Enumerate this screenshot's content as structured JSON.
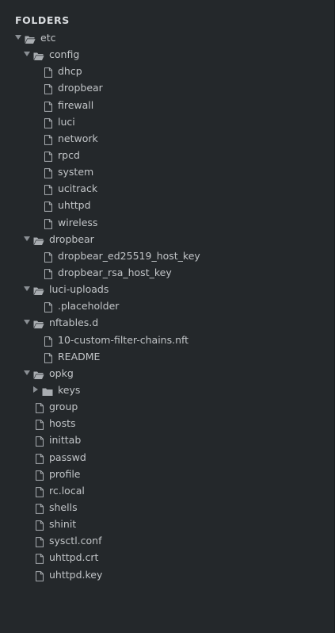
{
  "header": {
    "title": "FOLDERS"
  },
  "tree": [
    {
      "label": "etc",
      "kind": "folder",
      "open": true,
      "depth": 0
    },
    {
      "label": "config",
      "kind": "folder",
      "open": true,
      "depth": 1
    },
    {
      "label": "dhcp",
      "kind": "file",
      "depth": 2
    },
    {
      "label": "dropbear",
      "kind": "file",
      "depth": 2
    },
    {
      "label": "firewall",
      "kind": "file",
      "depth": 2
    },
    {
      "label": "luci",
      "kind": "file",
      "depth": 2
    },
    {
      "label": "network",
      "kind": "file",
      "depth": 2
    },
    {
      "label": "rpcd",
      "kind": "file",
      "depth": 2
    },
    {
      "label": "system",
      "kind": "file",
      "depth": 2
    },
    {
      "label": "ucitrack",
      "kind": "file",
      "depth": 2
    },
    {
      "label": "uhttpd",
      "kind": "file",
      "depth": 2
    },
    {
      "label": "wireless",
      "kind": "file",
      "depth": 2
    },
    {
      "label": "dropbear",
      "kind": "folder",
      "open": true,
      "depth": 1
    },
    {
      "label": "dropbear_ed25519_host_key",
      "kind": "file",
      "depth": 2
    },
    {
      "label": "dropbear_rsa_host_key",
      "kind": "file",
      "depth": 2
    },
    {
      "label": "luci-uploads",
      "kind": "folder",
      "open": true,
      "depth": 1
    },
    {
      "label": ".placeholder",
      "kind": "file",
      "depth": 2
    },
    {
      "label": "nftables.d",
      "kind": "folder",
      "open": true,
      "depth": 1
    },
    {
      "label": "10-custom-filter-chains.nft",
      "kind": "file",
      "depth": 2
    },
    {
      "label": "README",
      "kind": "file",
      "depth": 2
    },
    {
      "label": "opkg",
      "kind": "folder",
      "open": true,
      "depth": 1
    },
    {
      "label": "keys",
      "kind": "folder",
      "open": false,
      "depth": 2
    },
    {
      "label": "group",
      "kind": "file",
      "depth": 1
    },
    {
      "label": "hosts",
      "kind": "file",
      "depth": 1
    },
    {
      "label": "inittab",
      "kind": "file",
      "depth": 1
    },
    {
      "label": "passwd",
      "kind": "file",
      "depth": 1
    },
    {
      "label": "profile",
      "kind": "file",
      "depth": 1
    },
    {
      "label": "rc.local",
      "kind": "file",
      "depth": 1
    },
    {
      "label": "shells",
      "kind": "file",
      "depth": 1
    },
    {
      "label": "shinit",
      "kind": "file",
      "depth": 1
    },
    {
      "label": "sysctl.conf",
      "kind": "file",
      "depth": 1
    },
    {
      "label": "uhttpd.crt",
      "kind": "file",
      "depth": 1
    },
    {
      "label": "uhttpd.key",
      "kind": "file",
      "depth": 1
    }
  ],
  "colors": {
    "background": "#24282b",
    "text": "#c2c5c8",
    "header": "#d9dcdf",
    "icon": "#a9adb1",
    "arrow": "#8a8f94"
  }
}
